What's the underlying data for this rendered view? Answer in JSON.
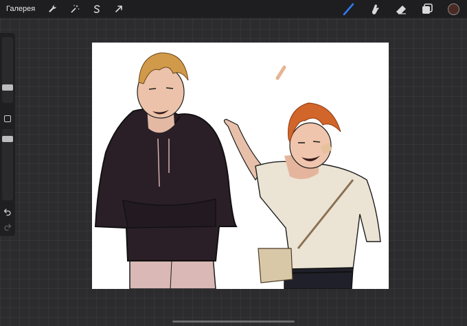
{
  "topbar": {
    "gallery_label": "Галерея",
    "left_tools": [
      "wrench-icon",
      "magic-wand-icon",
      "selection-icon",
      "transform-arrow-icon"
    ],
    "right_tools": [
      "brush-icon",
      "smudge-icon",
      "eraser-icon",
      "layers-icon"
    ],
    "active_tool": "brush-icon",
    "accent_color": "#2f7cf6",
    "current_color": "#4a2a22"
  },
  "sidebar": {
    "controls": [
      "brush-size-slider",
      "modify-button",
      "opacity-slider",
      "undo-icon",
      "redo-icon"
    ]
  },
  "canvas": {
    "background": "#ffffff",
    "content": "artwork-illustration"
  }
}
